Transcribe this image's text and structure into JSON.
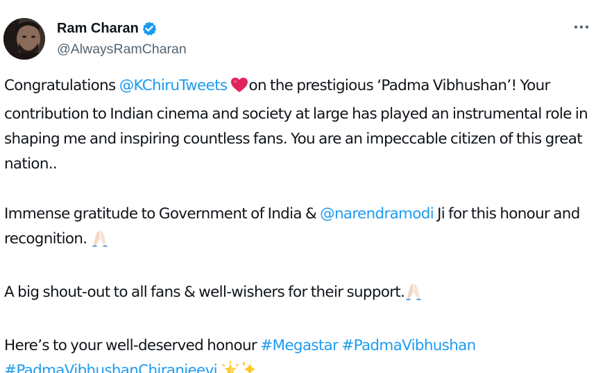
{
  "author": {
    "display_name": "Ram Charan",
    "handle": "@AlwaysRamCharan",
    "verified": true,
    "verified_color": "#1d9bf0"
  },
  "menu": {
    "icon": "more-horizontal-icon"
  },
  "colors": {
    "text": "#0f1419",
    "secondary": "#536471",
    "link": "#1d9bf0",
    "heart": "#e0245e"
  },
  "tweet": {
    "p1": {
      "t1": "Congratulations ",
      "mention": "@KChiruTweets",
      "emoji_heart": "red-heart",
      "t2": "on the prestigious ‘Padma Vibhushan’! Your contribution to Indian cinema and society at large has played an instrumental role in shaping me and inspiring countless fans. You are an impeccable citizen of this great nation.."
    },
    "p2": {
      "t1": "Immense gratitude to Government of India & ",
      "mention": "@narendramodi",
      "t2": " Ji for this honour and recognition. ",
      "emoji": "folded-hands"
    },
    "p3": {
      "t1": "A big shout-out to all fans & well-wishers for their support.",
      "emoji": "folded-hands"
    },
    "p4": {
      "t1": "Here’s to your well-deserved honour ",
      "hashtag1": "#Megastar",
      "hashtag2": "#PadmaVibhushan",
      "hashtag3": "#PadmaVibhushanChiranjeevi",
      "emoji1": "glowing-star",
      "emoji2": "sparkles"
    }
  }
}
